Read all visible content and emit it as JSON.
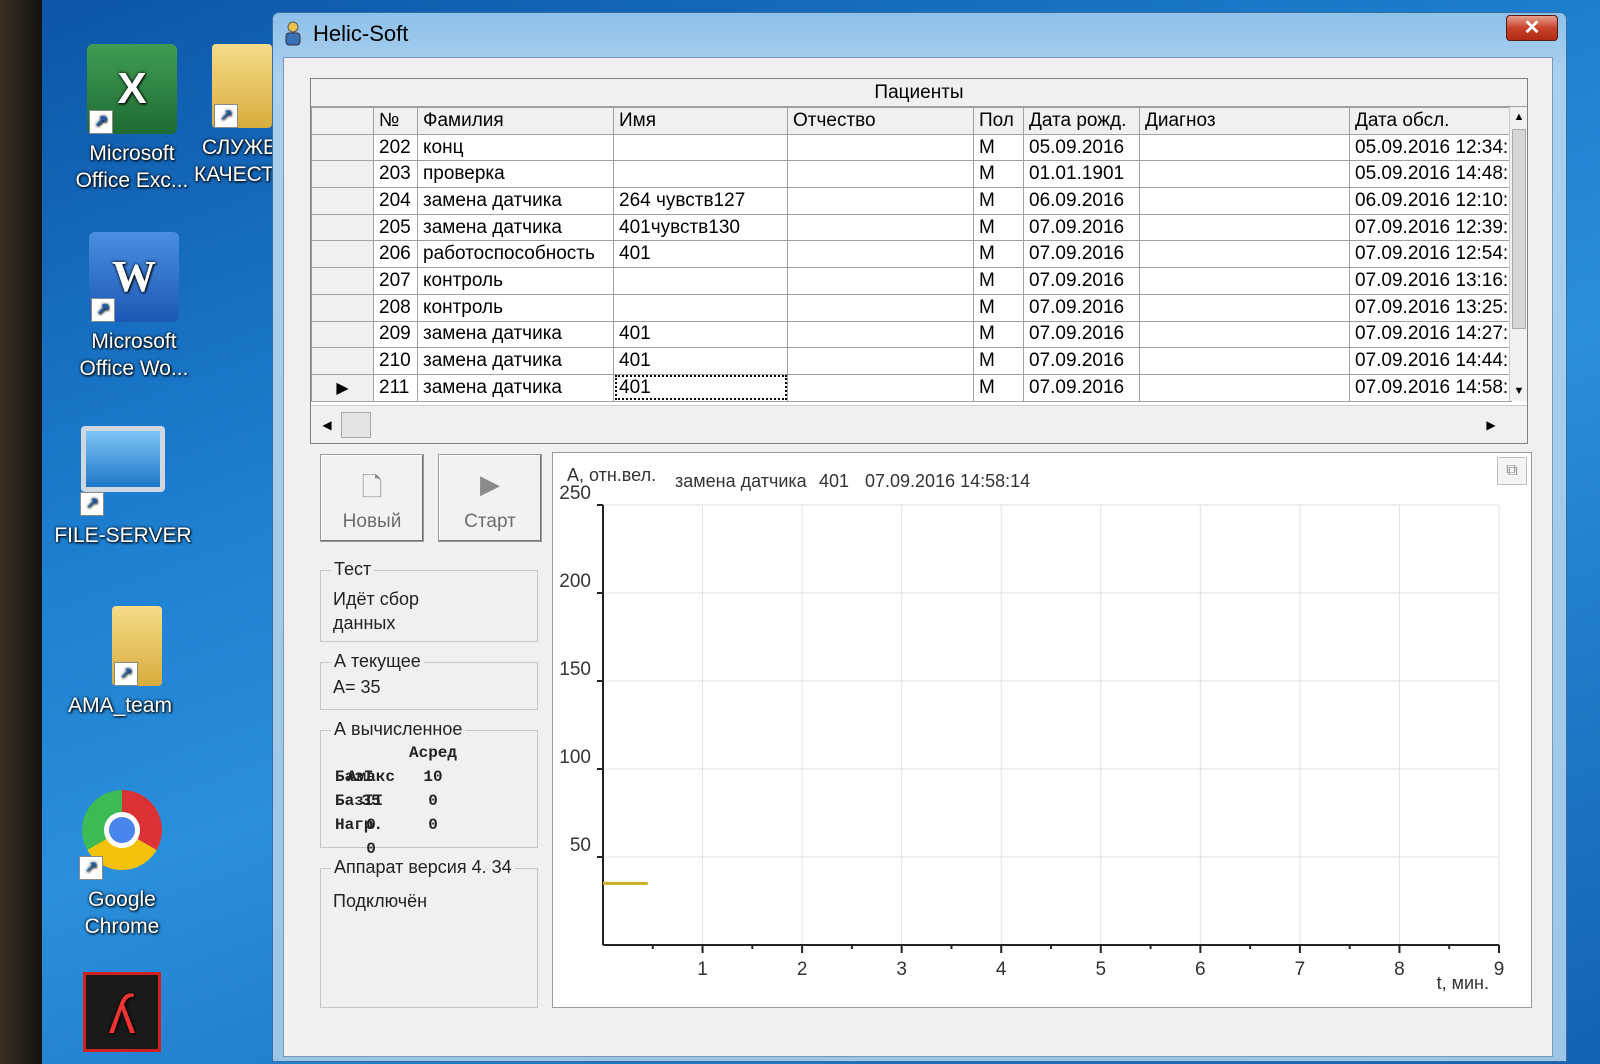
{
  "desktop": {
    "icons": [
      {
        "label_1": "Microsoft",
        "label_2": "Office Exc..."
      },
      {
        "label_1": "СЛУЖБ",
        "label_2": "КАЧЕСТ"
      },
      {
        "label_1": "Microsoft",
        "label_2": "Office Wo..."
      },
      {
        "label_1": "FILE-SERVER",
        "label_2": ""
      },
      {
        "label_1": "AMA_team",
        "label_2": ""
      },
      {
        "label_1": "Google",
        "label_2": "Chrome"
      }
    ]
  },
  "window": {
    "title": "Helic-Soft",
    "close_label": "✕"
  },
  "patients": {
    "caption": "Пациенты",
    "columns": [
      "№",
      "Фамилия",
      "Имя",
      "Отчество",
      "Пол",
      "Дата рожд.",
      "Диагноз",
      "Дата обсл."
    ],
    "rows": [
      [
        "",
        "202",
        "конц",
        "",
        "",
        "М",
        "05.09.2016",
        "",
        "05.09.2016 12:34:("
      ],
      [
        "",
        "203",
        "проверка",
        "",
        "",
        "М",
        "01.01.1901",
        "",
        "05.09.2016 14:48:"
      ],
      [
        "",
        "204",
        "замена датчика",
        "264 чувств127",
        "",
        "М",
        "06.09.2016",
        "",
        "06.09.2016 12:10:-"
      ],
      [
        "",
        "205",
        "замена датчика",
        "401чувств130",
        "",
        "М",
        "07.09.2016",
        "",
        "07.09.2016 12:39:."
      ],
      [
        "",
        "206",
        "работоспособность",
        "401",
        "",
        "М",
        "07.09.2016",
        "",
        "07.09.2016 12:54:-"
      ],
      [
        "",
        "207",
        "контроль",
        "",
        "",
        "М",
        "07.09.2016",
        "",
        "07.09.2016 13:16:"
      ],
      [
        "",
        "208",
        "контроль",
        "",
        "",
        "М",
        "07.09.2016",
        "",
        "07.09.2016 13:25:-"
      ],
      [
        "",
        "209",
        "замена датчика",
        "401",
        "",
        "М",
        "07.09.2016",
        "",
        "07.09.2016 14:27:("
      ],
      [
        "",
        "210",
        "замена датчика",
        "401",
        "",
        "М",
        "07.09.2016",
        "",
        "07.09.2016 14:44:-"
      ],
      [
        "▶",
        "211",
        "замена датчика",
        "401",
        "",
        "М",
        "07.09.2016",
        "",
        "07.09.2016 14:58:"
      ]
    ]
  },
  "toolbar": {
    "new_label": "Новый",
    "start_label": "Старт"
  },
  "test_box": {
    "legend": "Тест",
    "line1": "Идёт сбор",
    "line2": "данных"
  },
  "current_box": {
    "legend": "А текущее",
    "value_text": "А= 35"
  },
  "calc_box": {
    "legend": "А вычисленное",
    "header": [
      "",
      "Асред",
      "Амакс"
    ],
    "rows": [
      [
        "БазI",
        "10",
        "35"
      ],
      [
        "БазII",
        "0",
        "0"
      ],
      [
        "Нагр.",
        "0",
        "0"
      ]
    ]
  },
  "device_box": {
    "legend": "Аппарат версия 4. 34",
    "status": "Подключён"
  },
  "chart_data": {
    "type": "line",
    "ylabel": "А, отн.вел.",
    "xlabel": "t, мин.",
    "header_name": "замена датчика",
    "header_value": "401",
    "header_datetime": "07.09.2016 14:58:14",
    "xlim": [
      0,
      9
    ],
    "ylim": [
      0,
      250
    ],
    "x_ticks": [
      1,
      2,
      3,
      4,
      5,
      6,
      7,
      8,
      9
    ],
    "y_ticks": [
      50,
      100,
      150,
      200,
      250
    ],
    "grid": true,
    "series": [
      {
        "color": "#c8b02a",
        "x": [
          0,
          0.45
        ],
        "y": [
          35,
          35
        ]
      }
    ]
  }
}
